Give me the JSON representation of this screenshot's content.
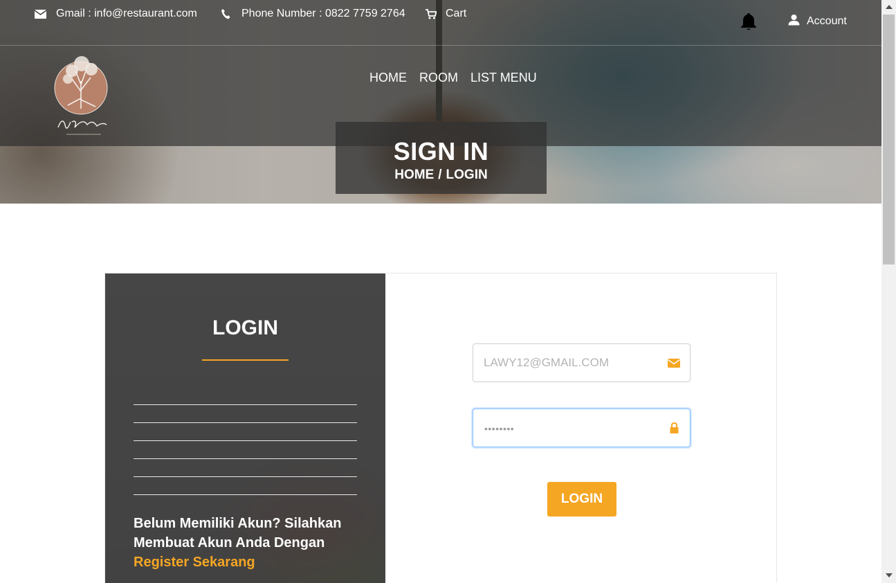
{
  "topbar": {
    "gmail": "Gmail : info@restaurant.com",
    "phone": "Phone Number : 0822 7759 2764",
    "cart": "Cart",
    "account": "Account"
  },
  "brand": {
    "logo_icon": "upsize-logo"
  },
  "nav": {
    "items": [
      "HOME",
      "ROOM",
      "LIST MENU"
    ]
  },
  "hero": {
    "title": "SIGN IN",
    "breadcrumb": {
      "home": "HOME",
      "separator": "/",
      "current": "LOGIN"
    }
  },
  "login_panel": {
    "title": "LOGIN",
    "note_text": "Belum Memiliki Akun? Silahkan Membuat Akun Anda Dengan",
    "register_link": "Register Sekarang"
  },
  "form": {
    "email_placeholder": "LAWY12@GMAIL.COM",
    "password_mask": "••••••••",
    "submit_label": "LOGIN"
  },
  "colors": {
    "accent": "#f5a623",
    "focus_border": "#80bdff"
  },
  "icons": [
    "mail-icon",
    "phone-icon",
    "cart-icon",
    "bell-icon",
    "user-icon",
    "envelope-icon",
    "lock-icon"
  ]
}
